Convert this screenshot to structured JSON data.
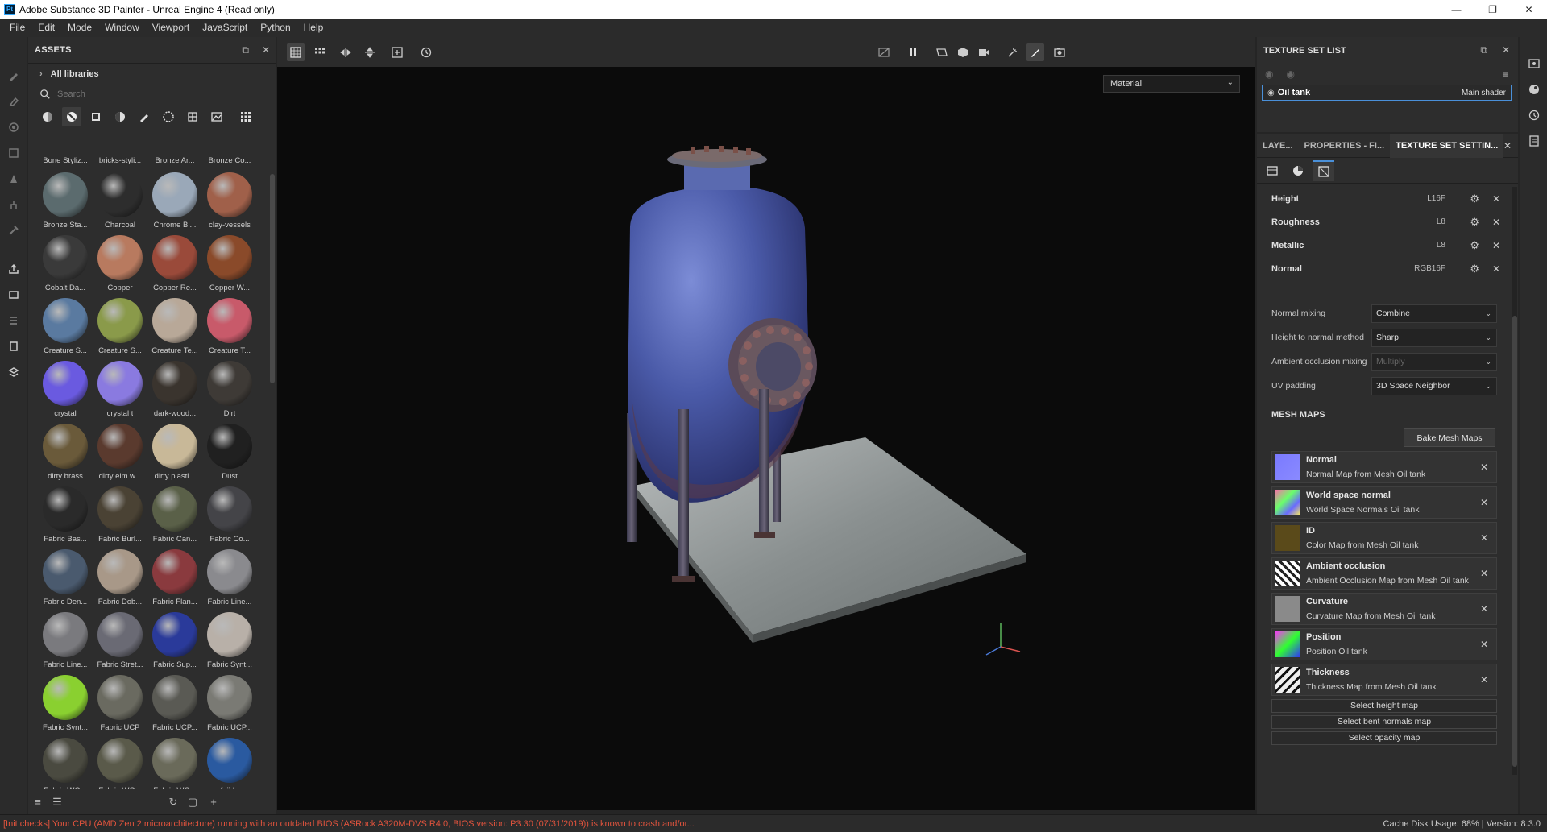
{
  "window": {
    "title": "Adobe Substance 3D Painter - Unreal Engine 4 (Read only)",
    "app_icon": "Pt"
  },
  "menu": [
    "File",
    "Edit",
    "Mode",
    "Window",
    "Viewport",
    "JavaScript",
    "Python",
    "Help"
  ],
  "assets": {
    "title": "ASSETS",
    "libraries_label": "All libraries",
    "search_placeholder": "Search",
    "partial_row": [
      "Bone Styliz...",
      "bricks-styli...",
      "Bronze Ar...",
      "Bronze Co..."
    ],
    "items": [
      {
        "label": "Bronze Sta...",
        "color": "#5b6b6e"
      },
      {
        "label": "Charcoal",
        "color": "#2d2d2d"
      },
      {
        "label": "Chrome Bl...",
        "color": "#9aa8b8"
      },
      {
        "label": "clay-vessels",
        "color": "#a0604a"
      },
      {
        "label": "Cobalt Da...",
        "color": "#3a3a3a"
      },
      {
        "label": "Copper",
        "color": "#b87a5f"
      },
      {
        "label": "Copper Re...",
        "color": "#9a4a3a"
      },
      {
        "label": "Copper W...",
        "color": "#8a4a2a"
      },
      {
        "label": "Creature S...",
        "color": "#5a7aa0"
      },
      {
        "label": "Creature S...",
        "color": "#8a9a4a"
      },
      {
        "label": "Creature Te...",
        "color": "#b8a898"
      },
      {
        "label": "Creature T...",
        "color": "#c85a6a"
      },
      {
        "label": "crystal",
        "color": "#6a5ae0"
      },
      {
        "label": "crystal t",
        "color": "#8a7ae0"
      },
      {
        "label": "dark-wood...",
        "color": "#3a342e"
      },
      {
        "label": "Dirt",
        "color": "#3e3a36"
      },
      {
        "label": "dirty brass",
        "color": "#6a5a3a"
      },
      {
        "label": "dirty elm w...",
        "color": "#5a3a2e"
      },
      {
        "label": "dirty plasti...",
        "color": "#c8b898"
      },
      {
        "label": "Dust",
        "color": "#202020"
      },
      {
        "label": "Fabric Bas...",
        "color": "#2a2a2a"
      },
      {
        "label": "Fabric Burl...",
        "color": "#4a4234"
      },
      {
        "label": "Fabric Can...",
        "color": "#5a6048"
      },
      {
        "label": "Fabric Co...",
        "color": "#444448"
      },
      {
        "label": "Fabric Den...",
        "color": "#4a5a6e"
      },
      {
        "label": "Fabric Dob...",
        "color": "#a89888"
      },
      {
        "label": "Fabric Flan...",
        "color": "#8a3a3e"
      },
      {
        "label": "Fabric Line...",
        "color": "#8a8a8e"
      },
      {
        "label": "Fabric Line...",
        "color": "#7a7a7e"
      },
      {
        "label": "Fabric Stret...",
        "color": "#6a6a74"
      },
      {
        "label": "Fabric Sup...",
        "color": "#2a3a9a"
      },
      {
        "label": "Fabric Synt...",
        "color": "#b8b0a8"
      },
      {
        "label": "Fabric Synt...",
        "color": "#8ad030"
      },
      {
        "label": "Fabric UCP",
        "color": "#6a6a60"
      },
      {
        "label": "Fabric UCP...",
        "color": "#5a5a54"
      },
      {
        "label": "Fabric UCP...",
        "color": "#7a7a74"
      },
      {
        "label": "Fabric WO...",
        "color": "#4a4a40"
      },
      {
        "label": "Fabric WO...",
        "color": "#5a5a4a"
      },
      {
        "label": "Fabric WO...",
        "color": "#6a6a5a"
      },
      {
        "label": "feiide",
        "color": "#2a5aa0"
      }
    ]
  },
  "viewport": {
    "mode": "Material"
  },
  "texture_set_list": {
    "title": "TEXTURE SET LIST",
    "set_name": "Oil tank",
    "shader": "Main shader"
  },
  "properties": {
    "tabs": [
      "LAYE...",
      "PROPERTIES - FI...",
      "TEXTURE SET SETTIN..."
    ],
    "channels": [
      {
        "name": "Height",
        "format": "L16F"
      },
      {
        "name": "Roughness",
        "format": "L8"
      },
      {
        "name": "Metallic",
        "format": "L8"
      },
      {
        "name": "Normal",
        "format": "RGB16F"
      }
    ],
    "settings": [
      {
        "label": "Normal mixing",
        "value": "Combine",
        "disabled": false
      },
      {
        "label": "Height to normal method",
        "value": "Sharp",
        "disabled": false
      },
      {
        "label": "Ambient occlusion mixing",
        "value": "Multiply",
        "disabled": true
      },
      {
        "label": "UV padding",
        "value": "3D Space Neighbor",
        "disabled": false
      }
    ],
    "mesh_maps_title": "MESH MAPS",
    "bake_button": "Bake Mesh Maps",
    "mesh_maps": [
      {
        "name": "Normal",
        "source": "Normal Map from Mesh Oil tank",
        "thumb": "normal"
      },
      {
        "name": "World space normal",
        "source": "World Space Normals Oil tank",
        "thumb": "worldnormal"
      },
      {
        "name": "ID",
        "source": "Color Map from Mesh Oil tank",
        "thumb": "id"
      },
      {
        "name": "Ambient occlusion",
        "source": "Ambient Occlusion Map from Mesh Oil tank",
        "thumb": "ao"
      },
      {
        "name": "Curvature",
        "source": "Curvature Map from Mesh Oil tank",
        "thumb": "curvature"
      },
      {
        "name": "Position",
        "source": "Position Oil tank",
        "thumb": "position"
      },
      {
        "name": "Thickness",
        "source": "Thickness Map from Mesh Oil tank",
        "thumb": "thickness"
      }
    ],
    "select_buttons": [
      "Select height map",
      "Select bent normals map",
      "Select opacity map"
    ]
  },
  "status": {
    "message": "[Init checks] Your CPU (AMD Zen 2 microarchitecture) running with an outdated BIOS (ASRock A320M-DVS R4.0, BIOS version: P3.30 (07/31/2019)) is known to crash and/or...",
    "cache": "Cache Disk Usage:   68% | Version: 8.3.0"
  }
}
